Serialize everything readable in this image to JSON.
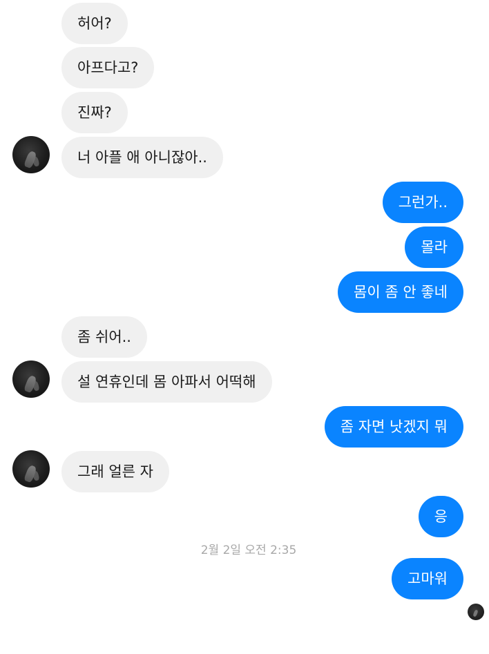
{
  "messages": [
    {
      "side": "in",
      "text": "허어?"
    },
    {
      "side": "in",
      "text": "아프다고?"
    },
    {
      "side": "in",
      "text": "진짜?"
    },
    {
      "side": "in",
      "text": "너 아플 애 아니잖아.."
    },
    {
      "side": "out",
      "text": "그런가.."
    },
    {
      "side": "out",
      "text": "몰라"
    },
    {
      "side": "out",
      "text": "몸이 좀 안 좋네"
    },
    {
      "side": "in",
      "text": "좀 쉬어.."
    },
    {
      "side": "in",
      "text": "설 연휴인데 몸 아파서 어떡해"
    },
    {
      "side": "out",
      "text": "좀 자면 낫겠지 뭐"
    },
    {
      "side": "in",
      "text": "그래 얼른 자"
    },
    {
      "side": "out",
      "text": "응"
    },
    {
      "side": "out",
      "text": "고마워"
    }
  ],
  "timestamp": "2월 2일 오전 2:35",
  "colors": {
    "outgoing_bubble": "#0a84ff",
    "incoming_bubble": "#f0f0f0",
    "timestamp_text": "#a8a8a8"
  }
}
